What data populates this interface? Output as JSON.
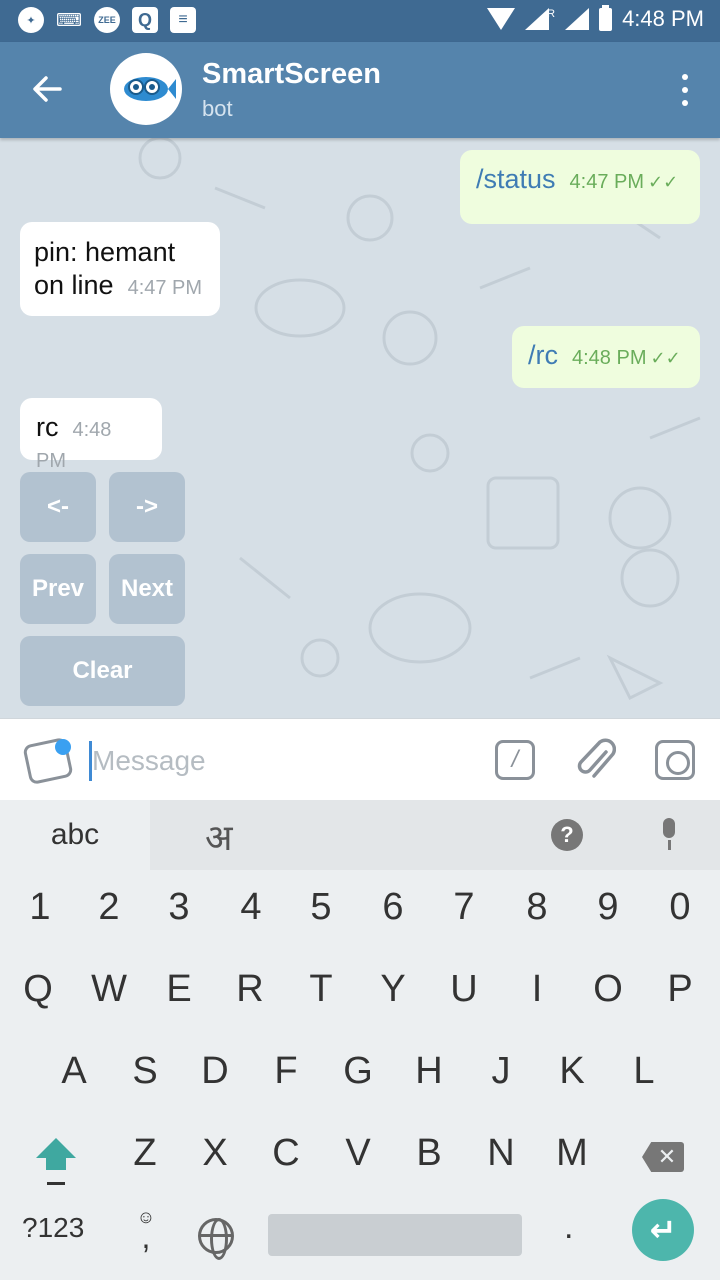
{
  "status_bar": {
    "icons": [
      "aperture-icon",
      "keyboard-icon",
      "zee-icon",
      "q-icon",
      "news-icon"
    ],
    "zee_label": "ZEE",
    "q_label": "Q",
    "roaming": "R",
    "time": "4:48 PM"
  },
  "header": {
    "title": "SmartScreen",
    "subtitle": "bot"
  },
  "messages": [
    {
      "text": "/status",
      "time": "4:47 PM",
      "direction": "out"
    },
    {
      "text": "pin: hemant on line",
      "line1": "pin: hemant",
      "line2": "on line",
      "time": "4:47 PM",
      "direction": "in"
    },
    {
      "text": "/rc",
      "time": "4:48 PM",
      "direction": "out"
    },
    {
      "text": "rc",
      "time": "4:48 PM",
      "direction": "in"
    }
  ],
  "bot_keyboard": {
    "row1": [
      "<-",
      "->"
    ],
    "row2": [
      "Prev",
      "Next"
    ],
    "row3": [
      "Clear"
    ]
  },
  "composer": {
    "placeholder": "Message",
    "slash_label": "/"
  },
  "keyboard": {
    "lang_abc": "abc",
    "lang_hindi": "अ",
    "help": "?",
    "numbers": [
      "1",
      "2",
      "3",
      "4",
      "5",
      "6",
      "7",
      "8",
      "9",
      "0"
    ],
    "row1": [
      "Q",
      "W",
      "E",
      "R",
      "T",
      "Y",
      "U",
      "I",
      "O",
      "P"
    ],
    "row2": [
      "A",
      "S",
      "D",
      "F",
      "G",
      "H",
      "J",
      "K",
      "L"
    ],
    "row3": [
      "Z",
      "X",
      "C",
      "V",
      "B",
      "N",
      "M"
    ],
    "symbols_key": "?123",
    "comma_key": ",",
    "period_key": "."
  },
  "colors": {
    "status_bar": "#3f6a92",
    "app_bar": "#5584ac",
    "outgoing_bubble": "#effdde",
    "incoming_bubble": "#ffffff",
    "accent": "#4db6ac"
  }
}
